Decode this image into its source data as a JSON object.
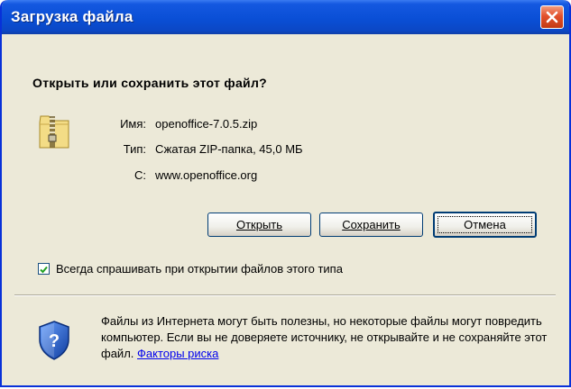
{
  "window": {
    "title": "Загрузка файла"
  },
  "question": "Открыть или сохранить этот файл?",
  "file_info": {
    "name_label": "Имя:",
    "name_value": "openoffice-7.0.5.zip",
    "type_label": "Тип:",
    "type_value": "Сжатая ZIP-папка, 45,0 МБ",
    "from_label": "С:",
    "from_value": "www.openoffice.org"
  },
  "buttons": {
    "open": "Открыть",
    "save": "Сохранить",
    "cancel": "Отмена"
  },
  "checkbox": {
    "label": "Всегда спрашивать при открытии файлов этого типа",
    "checked": true
  },
  "warning": {
    "text": "Файлы из Интернета могут быть полезны, но некоторые файлы могут повредить компьютер. Если вы не доверяете источнику, не открывайте и не сохраняйте этот файл.",
    "link": "Факторы риска"
  },
  "icons": {
    "close": "close-icon",
    "file": "zip-folder-icon",
    "security": "security-shield-icon"
  },
  "colors": {
    "titlebar": "#0a4fd6",
    "dialog_bg": "#ece9d8",
    "close_button": "#e2502c",
    "link": "#0000ee"
  }
}
